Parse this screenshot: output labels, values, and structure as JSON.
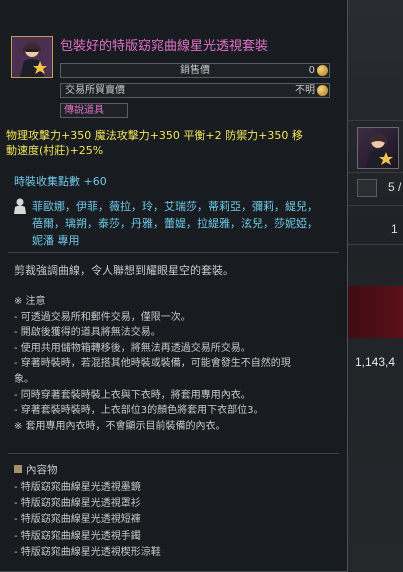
{
  "background": {
    "page_indicator": "5 /",
    "count_value": "1",
    "money_value": "1,143,4"
  },
  "tooltip": {
    "title": "包裝好的特版窈窕曲線星光透視套裝",
    "sell_label": "銷售價",
    "sell_value": "0",
    "trade_label": "交易所貿賣價",
    "trade_value": "不明",
    "grade": "傳說道具",
    "stats": "物理攻擊力+350 魔法攻擊力+350 平衡+2 防禦力+350 移動速度(村莊)+25%",
    "collection": "時裝收集點數 +60",
    "characters_line1": "菲歐娜，伊菲，薇拉，玲，艾瑞莎，蒂莉亞，彌莉，緹兒，",
    "characters_line2": "蓓爾，璃朔，泰莎，丹雅，蕾媞，拉緹雅，泫兒，莎妮婭，",
    "characters_line3": "妮潘 專用",
    "description": "剪裁強調曲線，令人聯想到耀眼星空的套裝。",
    "notes": [
      "※ 注意",
      "- 可透過交易所和郵件交易，僅限一次。",
      "- 開啟後獲得的道具將無法交易。",
      "- 使用共用儲物箱轉移後，將無法再透過交易所交易。",
      "- 穿著時裝時，若混搭其他時裝或裝備，可能會發生不自然的現",
      "象。",
      "- 同時穿著套裝時裝上衣與下衣時，將套用專用內衣。",
      "- 穿著套裝時裝時，上衣部位3的顏色將套用下衣部位3。",
      "※ 套用專用內衣時，不會顯示目前裝備的內衣。"
    ],
    "contents_title": "內容物",
    "contents": [
      "- 特版窈窕曲線星光透視墨鏡",
      "- 特版窈窕曲線星光透視罩衫",
      "- 特版窈窕曲線星光透視短褲",
      "- 特版窈窕曲線星光透視手鐲",
      "- 特版窈窕曲線星光透視楔形涼鞋"
    ]
  },
  "icons": {
    "item": "outfit-box-icon",
    "coin": "gold-coin-icon",
    "character": "character-silhouette-icon"
  },
  "colors": {
    "title": "#e070c8",
    "stats": "#f2e65a",
    "collection": "#6fc9e8",
    "characters": "#6fc9e8",
    "grade": "#e070c8"
  }
}
